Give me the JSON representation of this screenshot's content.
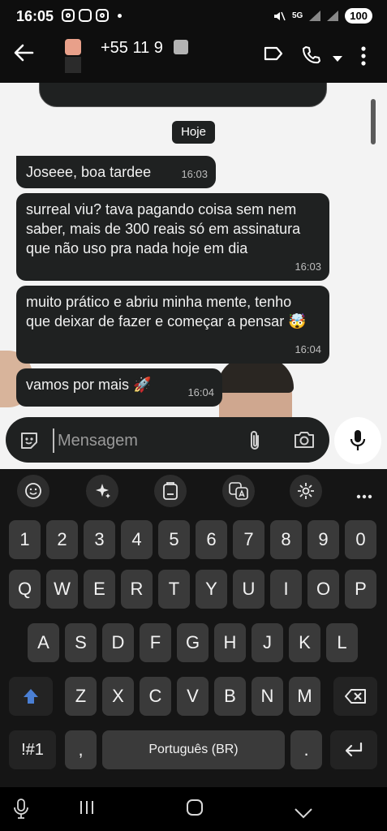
{
  "status_bar": {
    "time": "16:05",
    "network": "5G",
    "battery": "100"
  },
  "header": {
    "contact_name": "+55 11 9"
  },
  "chat": {
    "date_chip": "Hoje",
    "messages": [
      {
        "text": "Joseee, boa tardee",
        "time": "16:03"
      },
      {
        "text": "surreal viu? tava pagando coisa sem nem saber, mais de 300 reais só em assinatura que não uso pra nada hoje em dia",
        "time": "16:03"
      },
      {
        "text": "muito prático e abriu minha mente, tenho que deixar de fazer e começar a pensar 🤯",
        "time": "16:04"
      },
      {
        "text": "vamos por mais 🚀",
        "time": "16:04"
      }
    ]
  },
  "composer": {
    "placeholder": "Mensagem"
  },
  "keyboard": {
    "row_numbers": [
      "1",
      "2",
      "3",
      "4",
      "5",
      "6",
      "7",
      "8",
      "9",
      "0"
    ],
    "row_q": [
      "Q",
      "W",
      "E",
      "R",
      "T",
      "Y",
      "U",
      "I",
      "O",
      "P"
    ],
    "row_a": [
      "A",
      "S",
      "D",
      "F",
      "G",
      "H",
      "J",
      "K",
      "L"
    ],
    "row_z": [
      "Z",
      "X",
      "C",
      "V",
      "B",
      "N",
      "M"
    ],
    "symbols_label": "!#1",
    "comma_label": ",",
    "space_label": "Português (BR)",
    "period_label": "."
  },
  "colors": {
    "bubble": "#1f2121",
    "chat_bg": "#f3f3f3",
    "key": "#3a3a3a",
    "shift_accent": "#4a7fd4"
  }
}
